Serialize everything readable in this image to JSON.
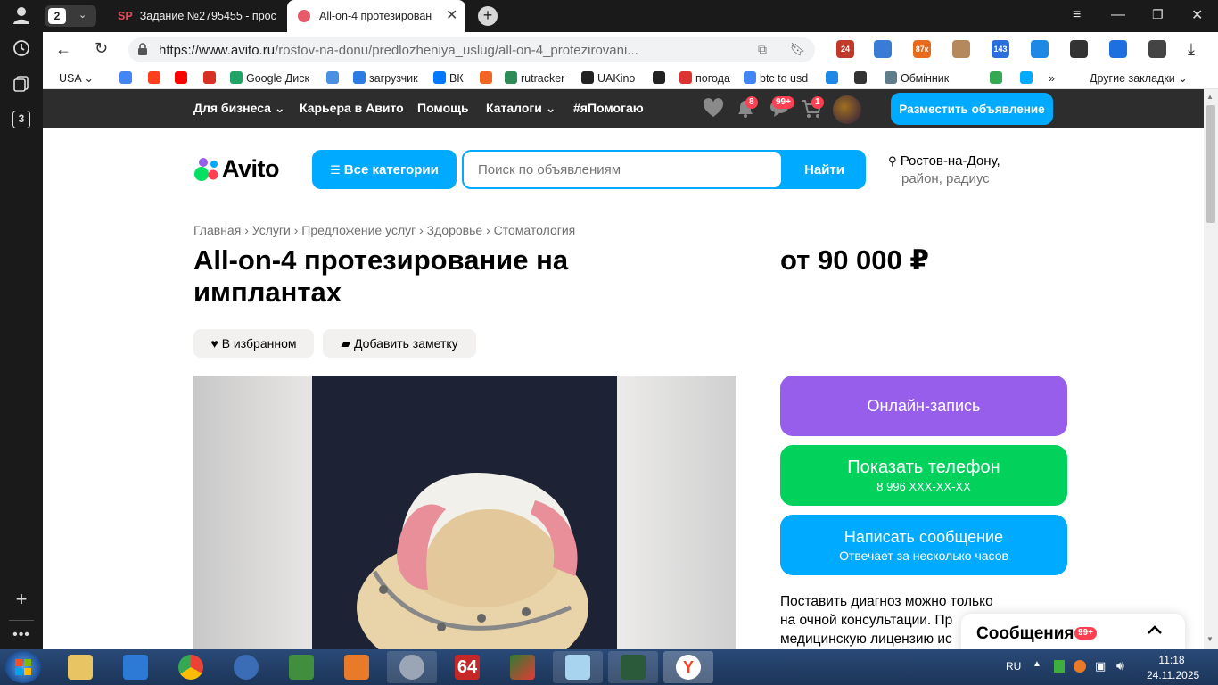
{
  "browser": {
    "tab_counter": "2",
    "sidebar_badge": "3",
    "tabs": [
      {
        "label": "Задание №2795455 - прос",
        "icon_text": "SP"
      },
      {
        "label": "All-on-4 протезирован",
        "icon_text": ""
      }
    ],
    "url_host": "https://www.avito.ru",
    "url_path": "/rostov-na-donu/predlozheniya_uslug/all-on-4_protezirovani...",
    "extensions": [
      {
        "text": "24",
        "color": "#c0392b"
      },
      {
        "text": "",
        "color": "#3a7bd5"
      },
      {
        "text": "87к",
        "color": "#e86a1a"
      },
      {
        "text": "",
        "color": "#b5885e"
      },
      {
        "text": "143",
        "color": "#2a6fdb"
      },
      {
        "text": "",
        "color": "#1e88e5"
      },
      {
        "text": "",
        "color": "#333333"
      },
      {
        "text": "",
        "color": "#1e6fe0"
      },
      {
        "text": "",
        "color": "#444444"
      }
    ],
    "bookmarks": [
      {
        "label": "USA",
        "color": "#ffffff"
      },
      {
        "label": "",
        "color": "#4285f4"
      },
      {
        "label": "",
        "color": "#fc3f1d"
      },
      {
        "label": "",
        "color": "#ff0000"
      },
      {
        "label": "",
        "color": "#d93025"
      },
      {
        "label": "Google Диск",
        "color": "#1fa463"
      },
      {
        "label": "",
        "color": "#4a90e2"
      },
      {
        "label": "загрузчик",
        "color": "#2c7be5"
      },
      {
        "label": "ВК",
        "color": "#0077ff"
      },
      {
        "label": "",
        "color": "#f26522"
      },
      {
        "label": "rutracker",
        "color": "#2e8b57"
      },
      {
        "label": "UAKino",
        "color": "#222222"
      },
      {
        "label": "",
        "color": "#222222"
      },
      {
        "label": "погода",
        "color": "#d33"
      },
      {
        "label": "btc to usd",
        "color": "#4285f4"
      },
      {
        "label": "",
        "color": "#1e88e5"
      },
      {
        "label": "",
        "color": "#333333"
      },
      {
        "label": "Обмінник",
        "color": "#607d8b"
      },
      {
        "label": "",
        "color": "#34a853"
      },
      {
        "label": "",
        "color": "#00aaff"
      }
    ],
    "bookmarks_more": "»",
    "other_bookmarks": "Другие закладки"
  },
  "avito": {
    "topnav": {
      "business": "Для бизнеса",
      "career": "Карьера в Авито",
      "help": "Помощь",
      "catalogs": "Каталоги",
      "help_hashtag": "#яПомогаю",
      "notif_badge": "8",
      "messages_badge": "99+",
      "cart_badge": "1",
      "post_ad": "Разместить объявление"
    },
    "logo_text": "Avito",
    "all_categories": "Все категории",
    "search_placeholder": "Поиск по объявлениям",
    "search_button": "Найти",
    "location_city": "Ростов-на-Дону,",
    "location_sub": "район, радиус",
    "breadcrumbs": [
      "Главная",
      "Услуги",
      "Предложение услуг",
      "Здоровье",
      "Стоматология"
    ],
    "breadcrumb_sep": "›",
    "title_line1": "All-on-4 протезирование на",
    "title_line2": "имплантах",
    "price": "от 90 000 ₽",
    "favorite_label": "В избранном",
    "note_label": "Добавить заметку",
    "online_booking": "Онлайн-запись",
    "show_phone": "Показать телефон",
    "phone_masked": "8 996 XXX-XX-XX",
    "write_message": "Написать сообщение",
    "reply_time": "Отвечает за несколько часов",
    "info_line1": "Поставить диагноз можно только",
    "info_line2": "на очной консультации. Пр",
    "info_line3": "медицинскую лицензию ис",
    "messages_panel": "Сообщения",
    "messages_panel_badge": "99+",
    "colors": {
      "purple": "#965eeb",
      "green": "#02d15c",
      "blue": "#00aaff",
      "dark_nav": "#2d2d2d"
    }
  },
  "taskbar": {
    "lang": "RU",
    "time": "11:18",
    "date": "24.11.2025",
    "app_64_label": "64"
  }
}
